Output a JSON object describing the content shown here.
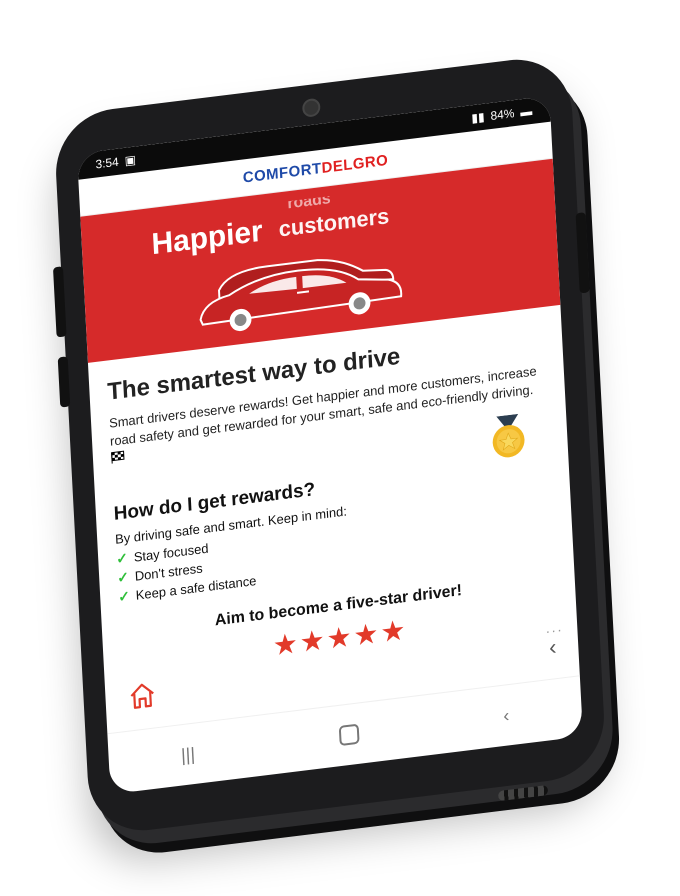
{
  "statusbar": {
    "time": "3:54",
    "battery": "84%"
  },
  "brand": {
    "part1": "COMFORT",
    "part2": "DELGRO"
  },
  "hero": {
    "title": "Happier",
    "rotating_prev": "roads",
    "rotating_current": "customers"
  },
  "content": {
    "headline": "The smartest way to drive",
    "intro": "Smart drivers deserve rewards! Get happier and more customers, increase road safety and get rewarded for your smart, safe and eco-friendly driving.",
    "subhead": "How do I get rewards?",
    "keep_in_mind": "By driving safe and smart. Keep in mind:",
    "tips": [
      "Stay focused",
      "Don't stress",
      "Keep a safe distance"
    ],
    "aim": "Aim to become a five-star driver!",
    "rating": {
      "value": 5,
      "max": 5
    }
  },
  "nav": {
    "more": "..."
  },
  "colors": {
    "accent": "#d62a2a",
    "brand_blue": "#1f4aa8",
    "check": "#2fbf3a",
    "star": "#e23a2a"
  },
  "icons": [
    "home-icon",
    "back-icon",
    "recent-apps-icon",
    "system-home-icon",
    "system-back-icon",
    "checkmark-icon",
    "medal-icon",
    "flag-icon",
    "star-icon"
  ]
}
